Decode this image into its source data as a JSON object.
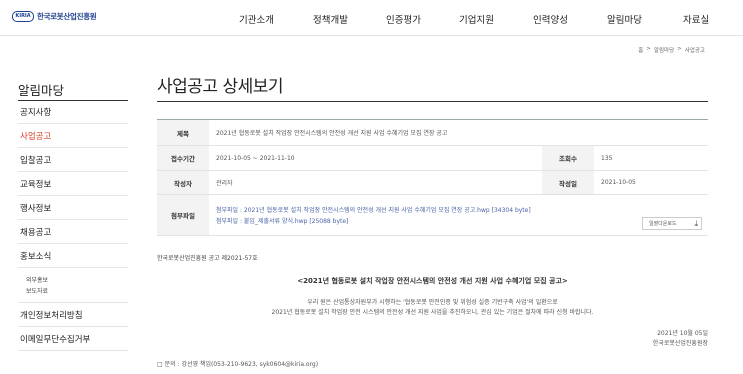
{
  "header": {
    "logo_mark": "KIRIA",
    "logo_text": "한국로봇산업진흥원",
    "nav": [
      "기관소개",
      "정책개발",
      "인증평가",
      "기업지원",
      "인력양성",
      "알림마당",
      "자료실"
    ]
  },
  "breadcrumb": [
    "홈",
    ">",
    "알림마당",
    ">",
    "사업공고"
  ],
  "sidebar": {
    "title": "알림마당",
    "items": [
      "공지사항",
      "사업공고",
      "입찰공고",
      "교육정보",
      "행사정보",
      "채용공고",
      "홍보소식"
    ],
    "sub_items": [
      "외부홍보",
      "보도자료"
    ],
    "bottom_items": [
      "개인정보처리방침",
      "이메일무단수집거부"
    ]
  },
  "page_title": "사업공고 상세보기",
  "detail": {
    "title_label": "제목",
    "title_value": "2021년 협동로봇 설치 작업장 안전시스템의 안전성 개선 지원 사업 수혜기업 모집 연장 공고",
    "period_label": "접수기간",
    "period_value": "2021-10-05 ~ 2021-11-10",
    "views_label": "조회수",
    "views_value": "135",
    "author_label": "작성자",
    "author_value": "관리자",
    "date_label": "작성일",
    "date_value": "2021-10-05",
    "files_label": "첨부파일",
    "files": [
      "첨부파일 : 2021년 협동로봇 설치 작업장 안전시스템의 안전성 개선 지원 사업 수혜기업 모집 연장 공고.hwp [34304 byte]",
      "첨부파일 : 붙임_제출서류 양식.hwp [25088 byte]"
    ],
    "download_label": "일괄다운로드"
  },
  "notice": {
    "doc_no": "한국로봇산업진흥원 공고 제2021-57호",
    "heading": "<2021년 협동로봇 설치 작업장 안전시스템의 안전성 개선 지원 사업 수혜기업 모집 공고>",
    "body_line1": "우리 원은 산업통상자원부가 시행하는 '협동로봇 안전인증 및 위험성 실증 기반구축 사업'의 일환으로",
    "body_line2": "2021년 협동로봇 설치 작업장 안전 시스템의 안전성 개선 지원 사업을 추진하오니, 관심 있는 기업은 절차에 따라 신청 바랍니다.",
    "date": "2021년 10월 05일",
    "org": "한국로봇산업진흥원장",
    "contact": "□ 문의 : 강선영 책임(053-210-9623, syk0604@kiria.org)"
  }
}
